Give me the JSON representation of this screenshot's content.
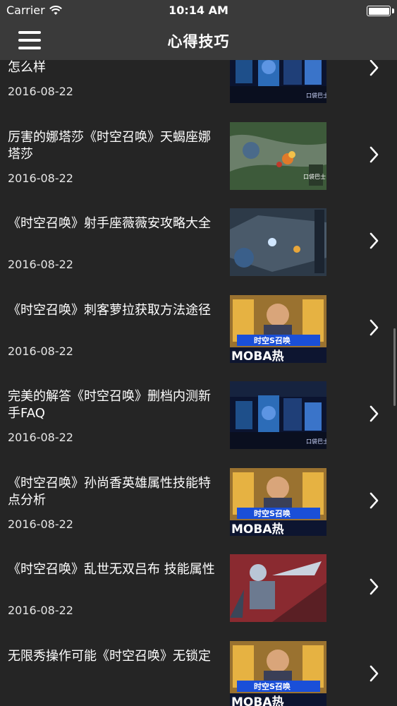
{
  "status_bar": {
    "carrier": "Carrier",
    "time": "10:14 AM",
    "battery_level": 1.0
  },
  "nav": {
    "title": "心得技巧",
    "menu_icon": "hamburger-menu-icon"
  },
  "articles": [
    {
      "title": "《时空召唤》无线宝宝皮皮技能属性怎么样",
      "date": "2016-08-22",
      "thumb": "stage"
    },
    {
      "title": "厉害的娜塔莎《时空召唤》天蝎座娜塔莎",
      "date": "2016-08-22",
      "thumb": "map"
    },
    {
      "title": "《时空召唤》射手座薇薇安攻略大全",
      "date": "2016-08-22",
      "thumb": "map2"
    },
    {
      "title": "《时空召唤》刺客萝拉获取方法途径",
      "date": "2016-08-22",
      "thumb": "poster"
    },
    {
      "title": "完美的解答《时空召唤》删档内测新手FAQ",
      "date": "2016-08-22",
      "thumb": "stage"
    },
    {
      "title": "《时空召唤》孙尚香英雄属性技能特点分析",
      "date": "2016-08-22",
      "thumb": "poster"
    },
    {
      "title": "《时空召唤》乱世无双吕布 技能属性",
      "date": "2016-08-22",
      "thumb": "hero"
    },
    {
      "title": "无限秀操作可能《时空召唤》无锁定",
      "date": "",
      "thumb": "poster"
    }
  ],
  "thumb_text": {
    "watermark": "口袋巴士",
    "poster_logo": "时空S召唤",
    "poster_banner": "MOBA热"
  },
  "colors": {
    "bar": "#3a3a3a",
    "background": "#252525",
    "text": "#ffffff"
  }
}
